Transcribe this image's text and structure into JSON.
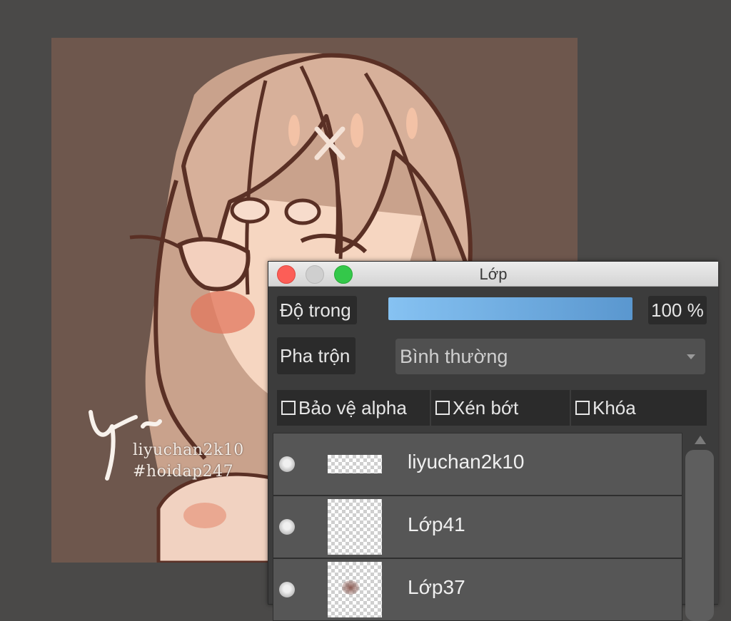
{
  "canvas": {
    "background_color": "#6e574d",
    "watermark_line1": "liyuchan2k10",
    "watermark_line2": "#hoidap247"
  },
  "layer_panel": {
    "title": "Lớp",
    "opacity_label": "Độ trong",
    "opacity_value": "100 %",
    "opacity_fraction": 1.0,
    "blend_label": "Pha trộn",
    "blend_mode": "Bình thường",
    "checkboxes": [
      {
        "label": "Bảo vệ alpha",
        "checked": false
      },
      {
        "label": "Xén bớt",
        "checked": false
      },
      {
        "label": "Khóa",
        "checked": false
      }
    ],
    "layers": [
      {
        "name": "liyuchan2k10",
        "visible": true
      },
      {
        "name": "Lớp41",
        "visible": true
      },
      {
        "name": "Lớp37",
        "visible": true
      }
    ]
  },
  "colors": {
    "workspace": "#4a4948",
    "opacity_fill": "#6aa8e0",
    "close_button": "#fc5e57",
    "maximize_button": "#34c84a"
  }
}
